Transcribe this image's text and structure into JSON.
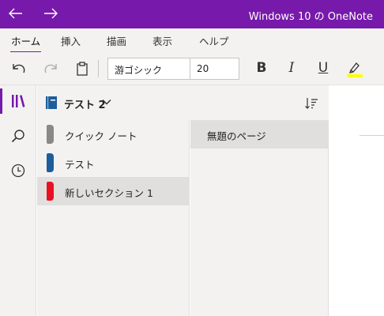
{
  "titlebar": {
    "title": "Windows 10 の OneNote",
    "back_icon": "arrow-left-icon",
    "forward_icon": "arrow-right-icon",
    "color": "#7719aa"
  },
  "ribbon": {
    "tabs": [
      {
        "label": "ホーム",
        "active": true
      },
      {
        "label": "挿入",
        "active": false
      },
      {
        "label": "描画",
        "active": false
      },
      {
        "label": "表示",
        "active": false
      },
      {
        "label": "ヘルプ",
        "active": false
      }
    ]
  },
  "toolbar": {
    "font_name": "游ゴシック",
    "font_size": "20",
    "bold": "B",
    "italic": "I",
    "underline": "U",
    "highlight_color": "#ffff00"
  },
  "notebook": {
    "name": "テスト 2"
  },
  "sections": [
    {
      "label": "クイック ノート",
      "color": "#8a8886",
      "selected": false
    },
    {
      "label": "テスト",
      "color": "#1d5d9b",
      "selected": false
    },
    {
      "label": "新しいセクション 1",
      "color": "#e81123",
      "selected": true
    }
  ],
  "pages": [
    {
      "label": "無題のページ",
      "selected": true
    }
  ]
}
